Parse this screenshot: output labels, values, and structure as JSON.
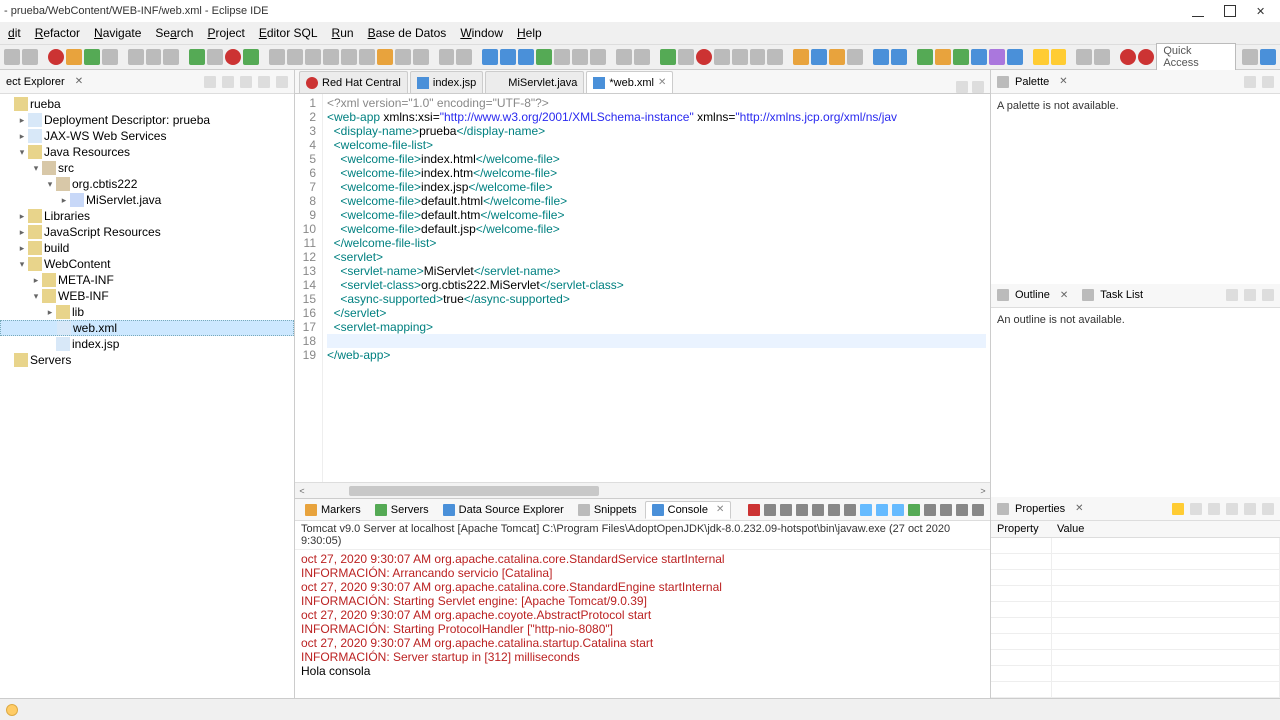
{
  "title": "- prueba/WebContent/WEB-INF/web.xml - Eclipse IDE",
  "menu": [
    "dit",
    "Refactor",
    "Navigate",
    "Search",
    "Project",
    "Editor SQL",
    "Run",
    "Base de Datos",
    "Window",
    "Help"
  ],
  "menu_underline": [
    0,
    0,
    0,
    2,
    0,
    0,
    0,
    0,
    0,
    0
  ],
  "quick_access": "Quick Access",
  "left_view": {
    "title": "ect Explorer"
  },
  "tree": [
    {
      "d": 0,
      "tw": "",
      "ic": "folder",
      "label": "rueba"
    },
    {
      "d": 1,
      "tw": ">",
      "ic": "file",
      "label": "Deployment Descriptor: prueba"
    },
    {
      "d": 1,
      "tw": ">",
      "ic": "file",
      "label": "JAX-WS Web Services"
    },
    {
      "d": 1,
      "tw": "v",
      "ic": "folder",
      "label": "Java Resources"
    },
    {
      "d": 2,
      "tw": "v",
      "ic": "pkg",
      "label": "src"
    },
    {
      "d": 3,
      "tw": "v",
      "ic": "pkg",
      "label": "org.cbtis222"
    },
    {
      "d": 4,
      "tw": ">",
      "ic": "java",
      "label": "MiServlet.java"
    },
    {
      "d": 1,
      "tw": ">",
      "ic": "folder",
      "label": "Libraries"
    },
    {
      "d": 1,
      "tw": ">",
      "ic": "folder",
      "label": "JavaScript Resources"
    },
    {
      "d": 1,
      "tw": ">",
      "ic": "folder",
      "label": "build"
    },
    {
      "d": 1,
      "tw": "v",
      "ic": "folder",
      "label": "WebContent"
    },
    {
      "d": 2,
      "tw": ">",
      "ic": "folder",
      "label": "META-INF"
    },
    {
      "d": 2,
      "tw": "v",
      "ic": "folder",
      "label": "WEB-INF"
    },
    {
      "d": 3,
      "tw": ">",
      "ic": "folder",
      "label": "lib"
    },
    {
      "d": 3,
      "tw": "",
      "ic": "file",
      "label": "web.xml",
      "sel": true
    },
    {
      "d": 3,
      "tw": "",
      "ic": "file",
      "label": "index.jsp"
    },
    {
      "d": 0,
      "tw": "",
      "ic": "folder",
      "label": "Servers"
    }
  ],
  "editor_tabs": [
    {
      "label": "Red Hat Central",
      "icon": "ic-red"
    },
    {
      "label": "index.jsp",
      "icon": "ic-blue"
    },
    {
      "label": "MiServlet.java",
      "icon": "ic-java"
    },
    {
      "label": "*web.xml",
      "icon": "ic-blue",
      "active": true,
      "close": true
    }
  ],
  "code_lines": [
    {
      "n": 1,
      "html": "<span class='p'>&lt;?xml version=\"1.0\" encoding=\"UTF-8\"?&gt;</span>"
    },
    {
      "n": 2,
      "html": "<span class='k'>&lt;web-app</span> <span class='t'>xmlns:xsi=</span><span class='s'>\"http://www.w3.org/2001/XMLSchema-instance\"</span> <span class='t'>xmlns=</span><span class='s'>\"http://xmlns.jcp.org/xml/ns/jav</span>"
    },
    {
      "n": 3,
      "html": "  <span class='k'>&lt;display-name&gt;</span><span class='t'>prueba</span><span class='k'>&lt;/display-name&gt;</span>"
    },
    {
      "n": 4,
      "html": "  <span class='k'>&lt;welcome-file-list&gt;</span>"
    },
    {
      "n": 5,
      "html": "    <span class='k'>&lt;welcome-file&gt;</span><span class='t'>index.html</span><span class='k'>&lt;/welcome-file&gt;</span>"
    },
    {
      "n": 6,
      "html": "    <span class='k'>&lt;welcome-file&gt;</span><span class='t'>index.htm</span><span class='k'>&lt;/welcome-file&gt;</span>"
    },
    {
      "n": 7,
      "html": "    <span class='k'>&lt;welcome-file&gt;</span><span class='t'>index.jsp</span><span class='k'>&lt;/welcome-file&gt;</span>"
    },
    {
      "n": 8,
      "html": "    <span class='k'>&lt;welcome-file&gt;</span><span class='t'>default.html</span><span class='k'>&lt;/welcome-file&gt;</span>"
    },
    {
      "n": 9,
      "html": "    <span class='k'>&lt;welcome-file&gt;</span><span class='t'>default.htm</span><span class='k'>&lt;/welcome-file&gt;</span>"
    },
    {
      "n": 10,
      "html": "    <span class='k'>&lt;welcome-file&gt;</span><span class='t'>default.jsp</span><span class='k'>&lt;/welcome-file&gt;</span>"
    },
    {
      "n": 11,
      "html": "  <span class='k'>&lt;/welcome-file-list&gt;</span>"
    },
    {
      "n": 12,
      "html": "  <span class='k'>&lt;servlet&gt;</span>"
    },
    {
      "n": 13,
      "html": "    <span class='k'>&lt;servlet-name&gt;</span><span class='t'>MiServlet</span><span class='k'>&lt;/servlet-name&gt;</span>"
    },
    {
      "n": 14,
      "html": "    <span class='k'>&lt;servlet-class&gt;</span><span class='t'>org.cbtis222.MiServlet</span><span class='k'>&lt;/servlet-class&gt;</span>"
    },
    {
      "n": 15,
      "html": "    <span class='k'>&lt;async-supported&gt;</span><span class='t'>true</span><span class='k'>&lt;/async-supported&gt;</span>"
    },
    {
      "n": 16,
      "html": "  <span class='k'>&lt;/servlet&gt;</span>"
    },
    {
      "n": 17,
      "html": "  <span class='k'>&lt;servlet-mapping&gt;</span>"
    },
    {
      "n": 18,
      "html": "",
      "cur": true
    },
    {
      "n": 19,
      "html": "<span class='k'>&lt;/web-app&gt;</span>"
    }
  ],
  "bottom_tabs": [
    {
      "label": "Markers",
      "icon": "ic-org"
    },
    {
      "label": "Servers",
      "icon": "ic-grn"
    },
    {
      "label": "Data Source Explorer",
      "icon": "ic-blue"
    },
    {
      "label": "Snippets",
      "icon": "ic-gry"
    },
    {
      "label": "Console",
      "icon": "ic-blue",
      "active": true,
      "close": true
    }
  ],
  "console_header": "Tomcat v9.0 Server at localhost [Apache Tomcat] C:\\Program Files\\AdoptOpenJDK\\jdk-8.0.232.09-hotspot\\bin\\javaw.exe (27 oct 2020 9:30:05)",
  "console_lines": [
    {
      "c": "red",
      "t": "oct 27, 2020 9:30:07 AM org.apache.catalina.core.StandardService startInternal"
    },
    {
      "c": "red",
      "t": "INFORMACIÓN: Arrancando servicio [Catalina]"
    },
    {
      "c": "red",
      "t": "oct 27, 2020 9:30:07 AM org.apache.catalina.core.StandardEngine startInternal"
    },
    {
      "c": "red",
      "t": "INFORMACIÓN: Starting Servlet engine: [Apache Tomcat/9.0.39]"
    },
    {
      "c": "red",
      "t": "oct 27, 2020 9:30:07 AM org.apache.coyote.AbstractProtocol start"
    },
    {
      "c": "red",
      "t": "INFORMACIÓN: Starting ProtocolHandler [\"http-nio-8080\"]"
    },
    {
      "c": "red",
      "t": "oct 27, 2020 9:30:07 AM org.apache.catalina.startup.Catalina start"
    },
    {
      "c": "red",
      "t": "INFORMACIÓN: Server startup in [312] milliseconds"
    },
    {
      "c": "",
      "t": "Hola consola"
    }
  ],
  "palette": {
    "title": "Palette",
    "msg": "A palette is not available."
  },
  "outline": {
    "title": "Outline",
    "msg": "An outline is not available.",
    "tab2": "Task List"
  },
  "properties": {
    "title": "Properties",
    "col1": "Property",
    "col2": "Value"
  },
  "toolbar_buttons": [
    "ic-gry",
    "ic-gry",
    "sep",
    "ic-red",
    "ic-org",
    "ic-grn",
    "ic-gry",
    "sep",
    "ic-gry",
    "ic-gry",
    "ic-gry",
    "sep",
    "ic-grn",
    "ic-gry",
    "ic-red",
    "ic-grn",
    "sep",
    "ic-gry",
    "ic-gry",
    "ic-gry",
    "ic-gry",
    "ic-gry",
    "ic-gry",
    "ic-org",
    "ic-gry",
    "ic-gry",
    "sep",
    "ic-gry",
    "ic-gry",
    "sep",
    "ic-blue",
    "ic-blue",
    "ic-blue",
    "ic-grn",
    "ic-gry",
    "ic-gry",
    "ic-gry",
    "sep",
    "ic-gry",
    "ic-gry",
    "sep",
    "ic-grn",
    "ic-gry",
    "ic-red",
    "ic-gry",
    "ic-gry",
    "ic-gry",
    "ic-gry",
    "sep",
    "ic-org",
    "ic-blue",
    "ic-org",
    "ic-gry",
    "sep",
    "ic-blue",
    "ic-blue",
    "sep",
    "ic-grn",
    "ic-org",
    "ic-grn",
    "ic-blue",
    "ic-pur",
    "ic-blue",
    "sep",
    "ic-yel",
    "ic-yel",
    "sep",
    "ic-gry",
    "ic-gry",
    "sep",
    "ic-red",
    "ic-red"
  ],
  "console_action_colors": [
    "#c33",
    "#888",
    "#888",
    "#888",
    "#888",
    "#888",
    "#888",
    "#6bf",
    "#6bf",
    "#6bf",
    "#5a5",
    "#888",
    "#888",
    "#888",
    "#888"
  ]
}
